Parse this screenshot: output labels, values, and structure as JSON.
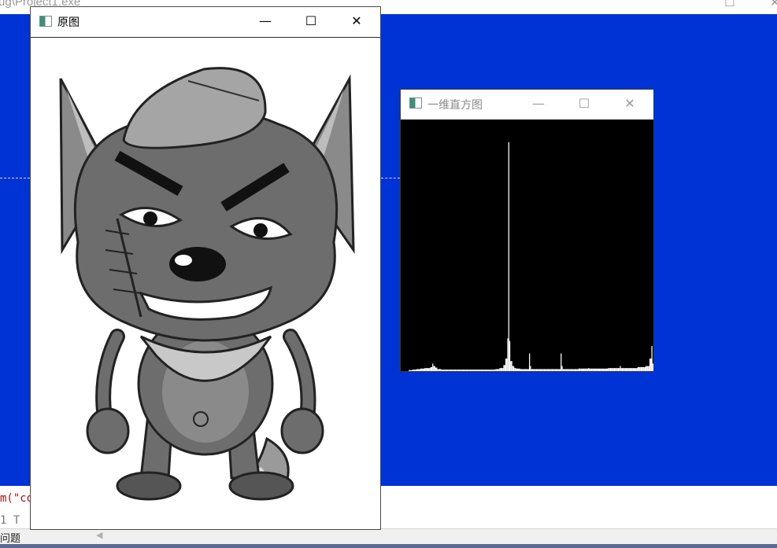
{
  "background_app": {
    "title": "ug\\Project1.exe",
    "code_lines": [
      "m(\"co",
      "1 T"
    ],
    "status_label": "问题"
  },
  "colors": {
    "desktop": "#0033d6",
    "histogram_bg": "#000000",
    "histogram_bars": "#ffffff",
    "image_window_bg": "#ffffff"
  },
  "window_original": {
    "title": "原图",
    "image_description_icon": "gray-wolf-cartoon-image"
  },
  "window_histogram": {
    "title": "一维直方图",
    "histogram": {
      "levels": 256,
      "note_peak_bin": 109,
      "bins": [
        [
          0,
          0.0
        ],
        [
          4,
          0.0
        ],
        [
          8,
          0.004
        ],
        [
          12,
          0.006
        ],
        [
          16,
          0.008
        ],
        [
          20,
          0.01
        ],
        [
          24,
          0.012
        ],
        [
          28,
          0.012
        ],
        [
          30,
          0.016
        ],
        [
          32,
          0.03
        ],
        [
          34,
          0.02
        ],
        [
          36,
          0.014
        ],
        [
          40,
          0.008
        ],
        [
          48,
          0.006
        ],
        [
          60,
          0.006
        ],
        [
          80,
          0.006
        ],
        [
          96,
          0.008
        ],
        [
          100,
          0.012
        ],
        [
          104,
          0.024
        ],
        [
          106,
          0.05
        ],
        [
          108,
          0.13
        ],
        [
          109,
          0.91
        ],
        [
          110,
          0.12
        ],
        [
          112,
          0.04
        ],
        [
          114,
          0.02
        ],
        [
          116,
          0.012
        ],
        [
          120,
          0.01
        ],
        [
          128,
          0.008
        ],
        [
          130,
          0.07
        ],
        [
          131,
          0.02
        ],
        [
          140,
          0.008
        ],
        [
          150,
          0.008
        ],
        [
          160,
          0.008
        ],
        [
          162,
          0.07
        ],
        [
          163,
          0.02
        ],
        [
          170,
          0.008
        ],
        [
          180,
          0.01
        ],
        [
          190,
          0.012
        ],
        [
          200,
          0.01
        ],
        [
          210,
          0.012
        ],
        [
          220,
          0.012
        ],
        [
          222,
          0.02
        ],
        [
          230,
          0.012
        ],
        [
          240,
          0.016
        ],
        [
          248,
          0.02
        ],
        [
          252,
          0.05
        ],
        [
          254,
          0.1
        ],
        [
          255,
          0.03
        ]
      ]
    }
  },
  "icons": {
    "minimize": "minimize-icon",
    "maximize": "maximize-icon",
    "close": "close-icon",
    "app": "opencv-window-icon"
  }
}
